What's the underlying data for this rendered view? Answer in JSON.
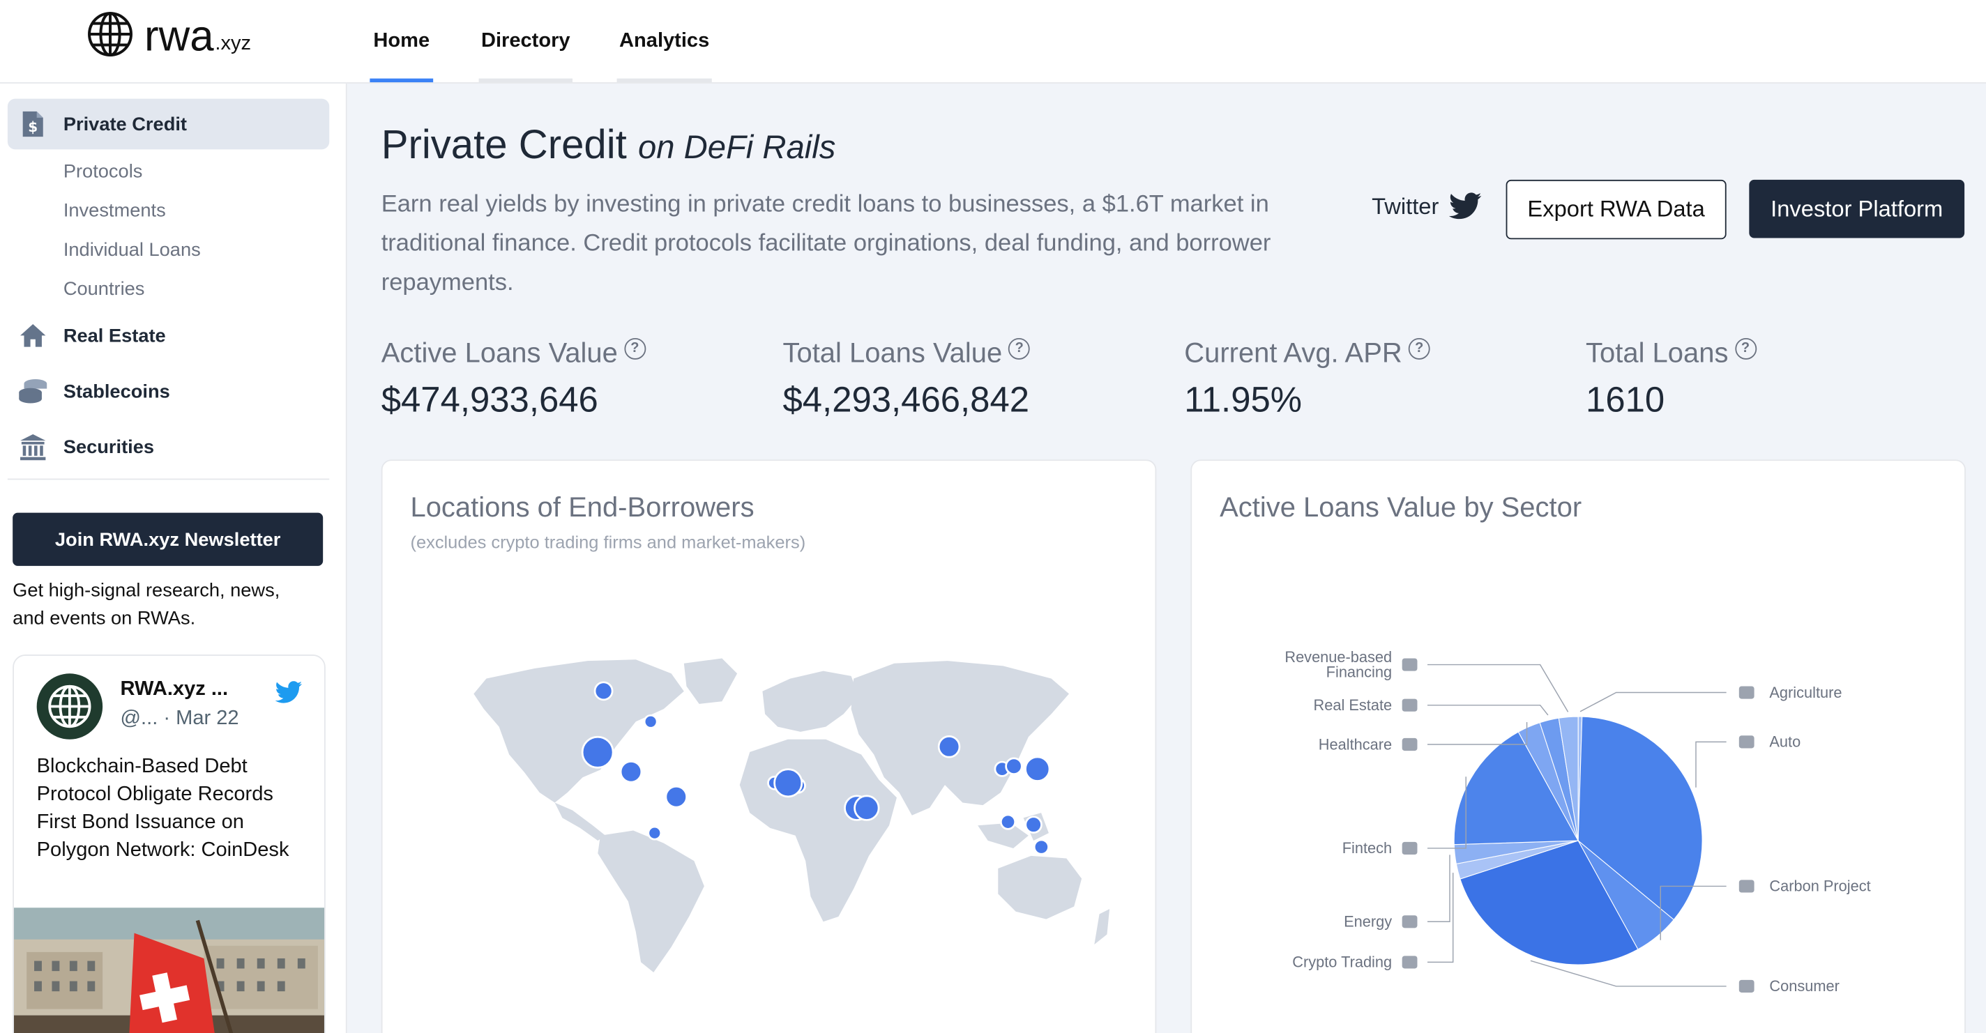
{
  "app": {
    "logo_main": "rwa",
    "logo_suffix": ".xyz"
  },
  "nav": {
    "tabs": [
      {
        "label": "Home",
        "active": true
      },
      {
        "label": "Directory",
        "active": false
      },
      {
        "label": "Analytics",
        "active": false
      }
    ]
  },
  "sidebar": {
    "items": [
      {
        "label": "Private Credit",
        "icon": "dollar-document-icon",
        "active": true
      },
      {
        "label": "Real Estate",
        "icon": "house-icon"
      },
      {
        "label": "Stablecoins",
        "icon": "coin-stack-icon"
      },
      {
        "label": "Securities",
        "icon": "bank-icon"
      }
    ],
    "subitems": [
      "Protocols",
      "Investments",
      "Individual Loans",
      "Countries"
    ],
    "newsletter_button": "Join RWA.xyz Newsletter",
    "newsletter_text": "Get high-signal research, news, and events on RWAs."
  },
  "tweet": {
    "name": "RWA.xyz ...",
    "handle": "@...",
    "date": "· Mar 22",
    "body": "Blockchain-Based Debt Protocol Obligate Records First Bond Issuance on Polygon Network: CoinDesk"
  },
  "page": {
    "title": "Private Credit",
    "title_suffix": "on DeFi Rails",
    "intro": "Earn real yields by investing in private credit loans to businesses, a $1.6T market in traditional finance. Credit protocols facilitate orginations, deal funding, and borrower repayments.",
    "twitter_label": "Twitter",
    "export_button": "Export RWA Data",
    "investor_button": "Investor Platform"
  },
  "stats": [
    {
      "label": "Active Loans Value",
      "value": "$474,933,646"
    },
    {
      "label": "Total Loans Value",
      "value": "$4,293,466,842"
    },
    {
      "label": "Current Avg. APR",
      "value": "11.95%"
    },
    {
      "label": "Total Loans",
      "value": "1610"
    }
  ],
  "map_card": {
    "title": "Locations of End-Borrowers",
    "subtitle": "(excludes crypto trading firms and market-makers)"
  },
  "sector_card": {
    "title": "Active Loans Value by Sector"
  },
  "colors": {
    "accent": "#3b82f6",
    "dark": "#1e293b",
    "bubble": "#4477e8"
  },
  "chart_data": [
    {
      "type": "pie",
      "title": "Active Loans Value by Sector",
      "categories": [
        "Agriculture",
        "Auto",
        "Carbon Project",
        "Consumer",
        "Crypto Trading",
        "Energy",
        "Fintech",
        "Healthcare",
        "Real Estate",
        "Revenue-based Financing"
      ],
      "values": [
        0.5,
        35.5,
        6.0,
        28.0,
        2.0,
        2.5,
        17.5,
        3.0,
        2.5,
        2.5
      ],
      "colors": [
        "#9fbdf5",
        "#4a82eb",
        "#5f91ef",
        "#3b73e6",
        "#a9c3f6",
        "#8cb0f3",
        "#4d84eb",
        "#7ea6f2",
        "#6d9bf0",
        "#94b6f4"
      ]
    },
    {
      "type": "scatter",
      "title": "Locations of End-Borrowers",
      "x": [
        -99,
        -75,
        -102,
        -85,
        -62,
        -73,
        -12,
        0,
        -5,
        30,
        35,
        77,
        104,
        110,
        122,
        107,
        120,
        124
      ],
      "y": [
        41,
        30,
        19,
        12,
        3,
        -10,
        8,
        7,
        8,
        -1,
        -1,
        21,
        13,
        14,
        13,
        -6,
        -7,
        -15
      ],
      "values": [
        3,
        1.5,
        7,
        4,
        4,
        1.5,
        1.5,
        2,
        6,
        5,
        5,
        4,
        2,
        2.5,
        5,
        2,
        2.5,
        2
      ]
    }
  ]
}
